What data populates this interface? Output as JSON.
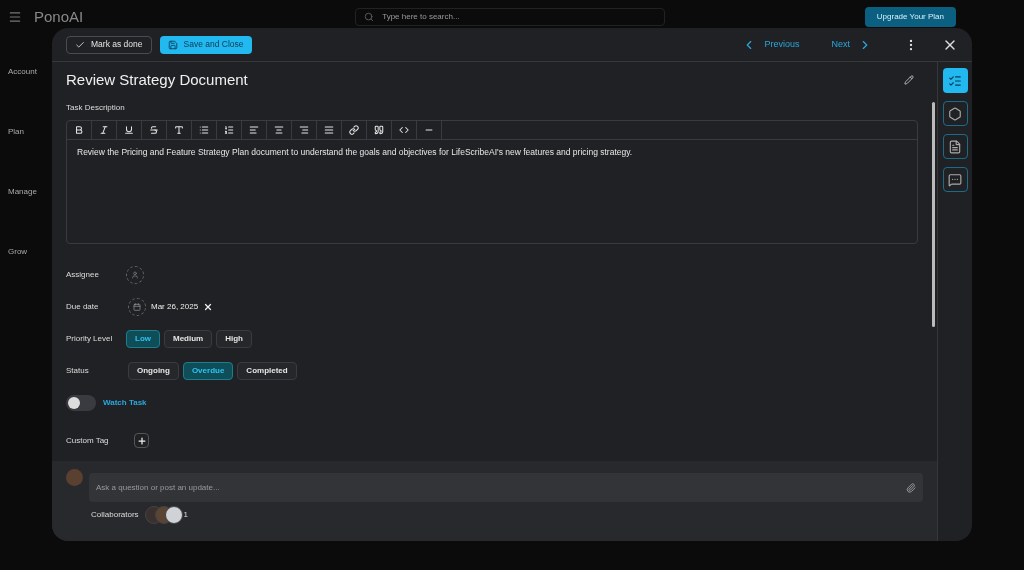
{
  "background": {
    "logo": "PonoAI",
    "search_placeholder": "Type here to search...",
    "upgrade_button": "Upgrade Your Plan",
    "sidebar_sections": [
      "Account",
      "Plan",
      "Manage",
      "Grow"
    ]
  },
  "header": {
    "mark_done": "Mark as done",
    "save_close": "Save and Close",
    "previous": "Previous",
    "next": "Next"
  },
  "task": {
    "title": "Review Strategy Document",
    "description_label": "Task Description",
    "description": "Review the Pricing and Feature Strategy Plan document to understand the goals and objectives for LifeScribeAI's new features and pricing strategy.",
    "assignee_label": "Assignee",
    "due_date_label": "Due date",
    "due_date": "Mar 26, 2025",
    "priority": {
      "label": "Priority Level",
      "options": [
        {
          "label": "Low",
          "selected": true
        },
        {
          "label": "Medium",
          "selected": false
        },
        {
          "label": "High",
          "selected": false
        }
      ]
    },
    "status": {
      "label": "Status",
      "options": [
        {
          "label": "Ongoing",
          "selected": false
        },
        {
          "label": "Overdue",
          "selected": true
        },
        {
          "label": "Completed",
          "selected": false
        }
      ]
    },
    "watch": {
      "label": "Watch Task",
      "on": false
    },
    "custom_tag_label": "Custom Tag"
  },
  "comment": {
    "placeholder": "Ask a question or post an update...",
    "collaborators_label": "Collaborators",
    "collaborator_count": "1"
  },
  "rail": [
    {
      "kind": "checklist",
      "selected": true
    },
    {
      "kind": "settings",
      "selected": false
    },
    {
      "kind": "document",
      "selected": false
    },
    {
      "kind": "chat",
      "selected": false
    }
  ]
}
